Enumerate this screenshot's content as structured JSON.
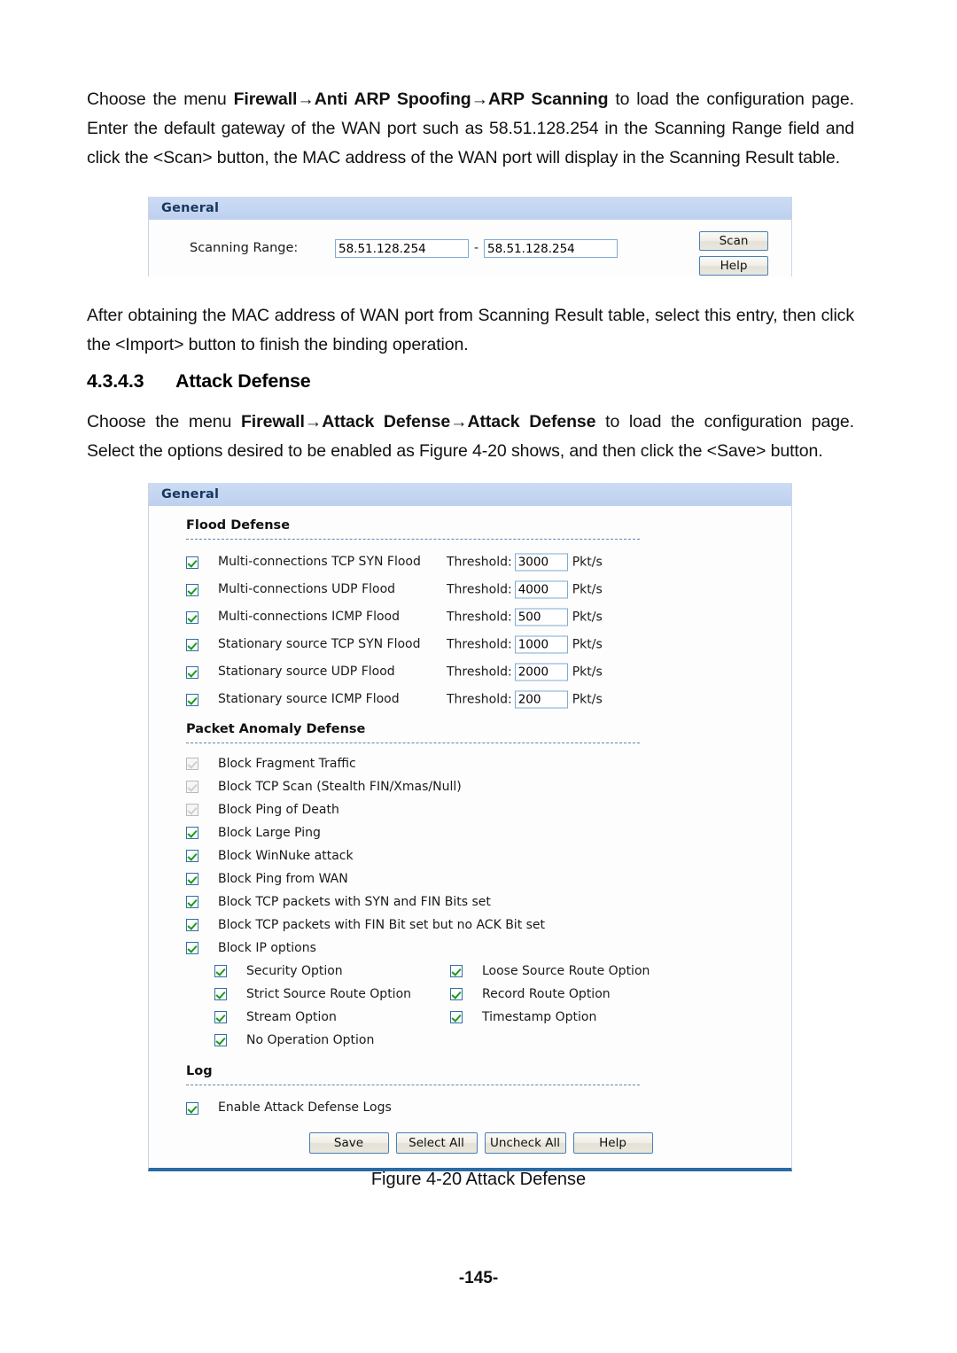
{
  "document": {
    "paragraph_1": "Choose the menu Firewall→Anti ARP Spoofing→ARP Scanning to load the configuration page. Enter the default gateway of the WAN port such as 58.51.128.254 in the Scanning Range field and click the <Scan> button, the MAC address of the WAN port will display in the Scanning Result table.",
    "p1_seg1": "Choose the menu ",
    "p1_bold1": "Firewall",
    "p1_arrow1": "→",
    "p1_bold2": "Anti ARP Spoofing",
    "p1_arrow2": "→",
    "p1_bold3": "ARP Scanning",
    "p1_seg2": " to load the configuration page. Enter the default gateway of the WAN port such as 58.51.128.254 in the Scanning Range field and click the <Scan> button, the MAC address of the WAN port will display in the Scanning Result table.",
    "paragraph_2": "After obtaining the MAC address of WAN port from Scanning Result table, select this entry, then click the <Import> button to finish the binding operation.",
    "heading_number": "4.3.4.3",
    "heading_title": "Attack Defense",
    "p3_seg1": "Choose the menu ",
    "p3_bold1": "Firewall",
    "p3_arrow1": "→",
    "p3_bold2": "Attack Defense",
    "p3_arrow2": "→",
    "p3_bold3": "Attack Defense",
    "p3_seg2": " to load the configuration page. Select the options desired to be enabled as Figure 4-20 shows, and then click the <Save> button.",
    "figure_caption": "Figure 4-20 Attack Defense",
    "page_number": "-145-"
  },
  "scan_panel": {
    "header": "General",
    "scanning_range_label": "Scanning Range:",
    "range_start": "58.51.128.254",
    "range_separator": "-",
    "range_end": "58.51.128.254",
    "scan_button": "Scan",
    "help_button": "Help"
  },
  "attack_panel": {
    "header": "General",
    "flood_section_title": "Flood Defense",
    "flood_rows": [
      {
        "label": "Multi-connections TCP SYN Flood",
        "checked": true,
        "threshold_label": "Threshold:",
        "threshold": "3000",
        "unit": "Pkt/s"
      },
      {
        "label": "Multi-connections UDP Flood",
        "checked": true,
        "threshold_label": "Threshold:",
        "threshold": "4000",
        "unit": "Pkt/s"
      },
      {
        "label": "Multi-connections ICMP Flood",
        "checked": true,
        "threshold_label": "Threshold:",
        "threshold": "500",
        "unit": "Pkt/s"
      },
      {
        "label": "Stationary source TCP SYN Flood",
        "checked": true,
        "threshold_label": "Threshold:",
        "threshold": "1000",
        "unit": "Pkt/s"
      },
      {
        "label": "Stationary source UDP Flood",
        "checked": true,
        "threshold_label": "Threshold:",
        "threshold": "2000",
        "unit": "Pkt/s"
      },
      {
        "label": "Stationary source ICMP Flood",
        "checked": true,
        "threshold_label": "Threshold:",
        "threshold": "200",
        "unit": "Pkt/s"
      }
    ],
    "packet_section_title": "Packet Anomaly Defense",
    "packet_rows": [
      {
        "label": "Block Fragment Traffic",
        "checked": true,
        "disabled": true
      },
      {
        "label": "Block TCP Scan (Stealth FIN/Xmas/Null)",
        "checked": true,
        "disabled": true
      },
      {
        "label": "Block Ping of Death",
        "checked": true,
        "disabled": true
      },
      {
        "label": "Block Large Ping",
        "checked": true,
        "disabled": false
      },
      {
        "label": "Block WinNuke attack",
        "checked": true,
        "disabled": false
      },
      {
        "label": "Block Ping from WAN",
        "checked": true,
        "disabled": false
      },
      {
        "label": "Block TCP packets with SYN and FIN Bits set",
        "checked": true,
        "disabled": false
      },
      {
        "label": "Block TCP packets with FIN Bit set but no ACK Bit set",
        "checked": true,
        "disabled": false
      },
      {
        "label": "Block IP options",
        "checked": true,
        "disabled": false
      }
    ],
    "ip_options": [
      {
        "label": "Security Option",
        "checked": true
      },
      {
        "label": "Loose Source Route Option",
        "checked": true
      },
      {
        "label": "Strict Source Route Option",
        "checked": true
      },
      {
        "label": "Record Route Option",
        "checked": true
      },
      {
        "label": "Stream Option",
        "checked": true
      },
      {
        "label": "Timestamp Option",
        "checked": true
      },
      {
        "label": "No Operation Option",
        "checked": true
      }
    ],
    "log_section_title": "Log",
    "log_row": {
      "label": "Enable Attack Defense Logs",
      "checked": true
    },
    "buttons": [
      "Save",
      "Select All",
      "Uncheck All",
      "Help"
    ]
  },
  "colors": {
    "panel_header_bg": "#c3d3ef",
    "panel_header_text": "#17365d",
    "panel_border": "#c8d6e5",
    "panel_bottom_rule": "#2a6aa6",
    "dashed_rule": "#5d87ad",
    "input_border": "#7eaad4",
    "button_border": "#4a7fb5",
    "check_green": "#1a9a1a",
    "checkbox_border": "#2f6ea5",
    "checkbox_disabled_border": "#b9b9b9"
  }
}
